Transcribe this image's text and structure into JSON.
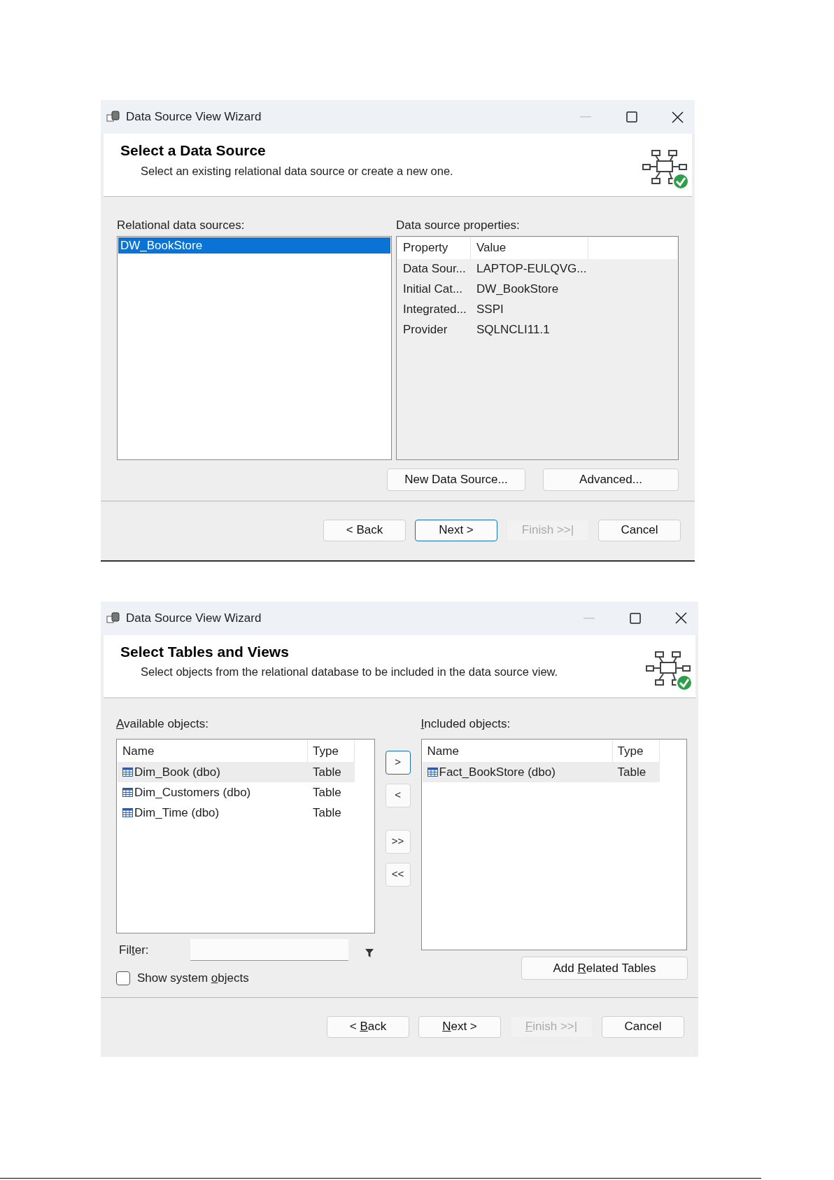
{
  "wizards": [
    {
      "kind": "data_source",
      "title": "Data Source View Wizard",
      "header": {
        "title": "Select a Data Source",
        "subtitle": "Select an existing relational data source or create a new one."
      },
      "sources": {
        "label": {
          "text": "Relational data sources:"
        },
        "items": [
          {
            "label": "DW_BookStore",
            "selected": true
          }
        ]
      },
      "properties": {
        "label": {
          "text": "Data source properties:"
        },
        "columns": [
          "Property",
          "Value"
        ],
        "rows": [
          [
            "Data Sour...",
            "LAPTOP-EULQVG..."
          ],
          [
            "Initial Cat...",
            "DW_BookStore"
          ],
          [
            "Integrated...",
            "SSPI"
          ],
          [
            "Provider",
            "SQLNCLI11.1"
          ]
        ]
      },
      "side_buttons": [
        {
          "text": "New Data Source..."
        },
        {
          "text": "Advanced..."
        }
      ],
      "nav_buttons": [
        {
          "text": "< Back",
          "default": false,
          "disabled": false
        },
        {
          "text": "Next >",
          "default": true,
          "disabled": false
        },
        {
          "text": "Finish >>|",
          "default": false,
          "disabled": true
        },
        {
          "text": "Cancel",
          "default": false,
          "disabled": false
        }
      ]
    },
    {
      "kind": "tables",
      "title": "Data Source View Wizard",
      "header": {
        "title": "Select Tables and Views",
        "subtitle": "Select objects from the relational database to be included in the data source view."
      },
      "available": {
        "label": {
          "key": "A",
          "post": "vailable objects:"
        },
        "columns": [
          "Name",
          "Type"
        ],
        "rows": [
          {
            "name": "Dim_Book (dbo)",
            "type": "Table",
            "selected": true
          },
          {
            "name": "Dim_Customers (dbo)",
            "type": "Table",
            "selected": false
          },
          {
            "name": "Dim_Time (dbo)",
            "type": "Table",
            "selected": false
          }
        ]
      },
      "move_buttons": [
        ">",
        "<",
        ">>",
        "<<"
      ],
      "included": {
        "label": {
          "key": "I",
          "post": "ncluded objects:"
        },
        "columns": [
          "Name",
          "Type"
        ],
        "rows": [
          {
            "name": "Fact_BookStore (dbo)",
            "type": "Table",
            "selected": true
          }
        ]
      },
      "filter": {
        "label": {
          "pre": "Fil",
          "key": "t",
          "post": "er:"
        }
      },
      "show_system": {
        "label": {
          "pre": "Show system ",
          "key": "o",
          "post": "bjects"
        },
        "checked": false
      },
      "related_button": {
        "label": {
          "pre": "Add ",
          "key": "R",
          "post": "elated Tables"
        }
      },
      "nav_buttons": [
        {
          "label": {
            "pre": "< ",
            "key": "B",
            "post": "ack"
          },
          "default": false,
          "disabled": false
        },
        {
          "label": {
            "key": "N",
            "post": "ext >"
          },
          "default": false,
          "disabled": false
        },
        {
          "label": {
            "key": "F",
            "post": "inish >>|"
          },
          "default": false,
          "disabled": true
        },
        {
          "text": "Cancel",
          "default": false,
          "disabled": false
        }
      ]
    }
  ]
}
